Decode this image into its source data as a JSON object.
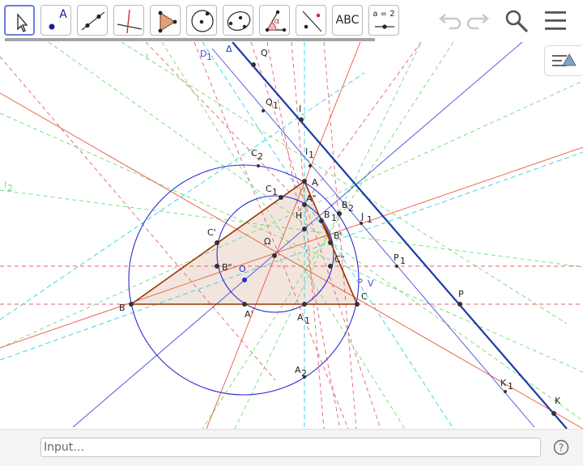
{
  "toolbar": {
    "tools": [
      {
        "name": "move"
      },
      {
        "name": "point",
        "label": "A"
      },
      {
        "name": "line"
      },
      {
        "name": "perpendicular-line"
      },
      {
        "name": "polygon"
      },
      {
        "name": "circle-center-point"
      },
      {
        "name": "conic-five-points"
      },
      {
        "name": "angle",
        "label": "α"
      },
      {
        "name": "reflect-about-line"
      },
      {
        "name": "text",
        "label": "ABC"
      },
      {
        "name": "slider",
        "label": "a = 2"
      }
    ],
    "right": [
      "undo-icon",
      "redo-icon",
      "search-icon",
      "menu-icon"
    ]
  },
  "canvas": {
    "labels": {
      "A": "A",
      "B": "B",
      "C": "C",
      "A1": "A",
      "A1sub": "1",
      "A2": "A",
      "A2sub": "2",
      "Aprime": "A'",
      "Adbl": "A\"",
      "B1": "B",
      "B1sub": "1",
      "B2": "B",
      "B2sub": "2",
      "Bprime": "B'",
      "Bdbl": "B\"",
      "C1": "C",
      "C1sub": "1",
      "C2": "C",
      "C2sub": "2",
      "Cprime": "C'",
      "Cdbl": "C\"",
      "H": "H",
      "O": "O",
      "Omega": "Ω",
      "I": "I",
      "I1": "I",
      "I1sub": "1",
      "J1": "J",
      "J1sub": "1",
      "K": "K",
      "K1": "K",
      "K1sub": "1",
      "P": "P",
      "P1": "P",
      "P1sub": "1",
      "Q": "Q",
      "Q1": "Q",
      "Q1sub": "1",
      "D1": "D",
      "D1sub": "1",
      "Delta": "Δ",
      "V": "V",
      "l1": "l",
      "l2": "l",
      "l2sub": "2"
    }
  },
  "input": {
    "placeholder": "Input…"
  },
  "help": {
    "label": "?"
  },
  "colors": {
    "triangle": "#993300",
    "triangle_fill": "#f2e5dd",
    "circle": "#2c2cd4",
    "thick_line": "#1c3aa8",
    "accent": "#6b7fd7"
  }
}
